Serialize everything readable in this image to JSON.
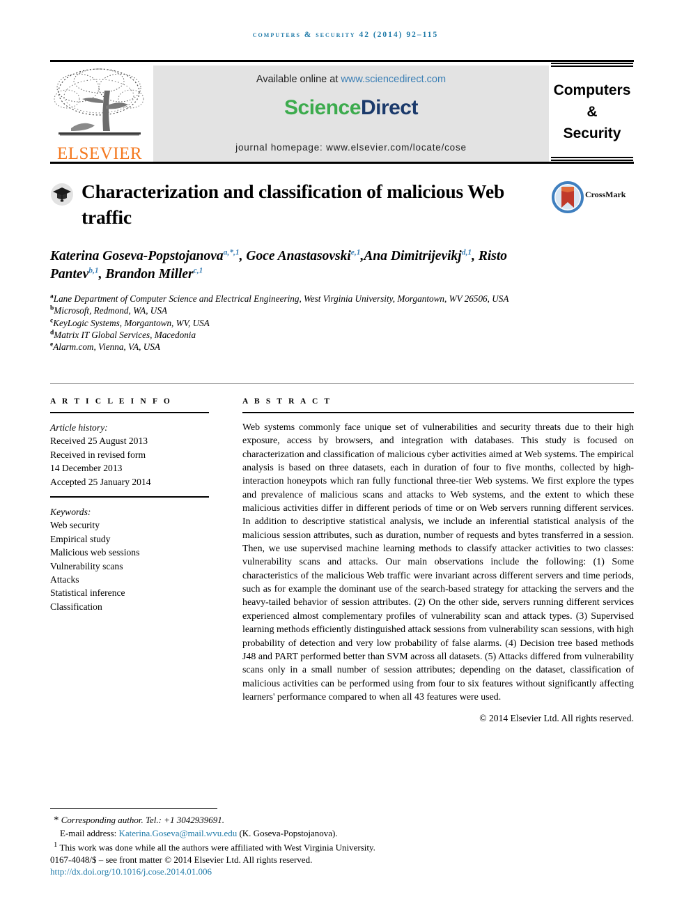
{
  "running_head": "Computers & Security 42 (2014) 92–115",
  "masthead": {
    "available_text": "Available online at",
    "available_url": "www.sciencedirect.com",
    "logo_part1": "Science",
    "logo_part2": "Direct",
    "homepage": "journal homepage: www.elsevier.com/locate/cose",
    "publisher": "ELSEVIER",
    "journal_line1": "Computers",
    "journal_line2": "&",
    "journal_line3": "Security"
  },
  "article": {
    "title": "Characterization and classification of malicious Web traffic",
    "crossmark_label": "CrossMark"
  },
  "authors": {
    "list": [
      {
        "name": "Katerina Goseva-Popstojanova",
        "marks": "a,*,1",
        "sep": ", "
      },
      {
        "name": "Goce Anastasovski",
        "marks": "e,1",
        "sep": ","
      },
      {
        "name": "Ana Dimitrijevikj",
        "marks": "d,1",
        "sep": ", "
      },
      {
        "name": "Risto Pantev",
        "marks": "b,1",
        "sep": ", "
      },
      {
        "name": "Brandon Miller",
        "marks": "c,1",
        "sep": ""
      }
    ]
  },
  "affiliations": [
    {
      "mark": "a",
      "text": "Lane Department of Computer Science and Electrical Engineering, West Virginia University, Morgantown, WV 26506, USA"
    },
    {
      "mark": "b",
      "text": "Microsoft, Redmond, WA, USA"
    },
    {
      "mark": "c",
      "text": "KeyLogic Systems, Morgantown, WV, USA"
    },
    {
      "mark": "d",
      "text": "Matrix IT Global Services, Macedonia"
    },
    {
      "mark": "e",
      "text": "Alarm.com, Vienna, VA, USA"
    }
  ],
  "article_info": {
    "heading": "A R T I C L E   I N F O",
    "history_title": "Article history:",
    "history": [
      "Received 25 August 2013",
      "Received in revised form",
      "14 December 2013",
      "Accepted 25 January 2014"
    ],
    "keywords_title": "Keywords:",
    "keywords": [
      "Web security",
      "Empirical study",
      "Malicious web sessions",
      "Vulnerability scans",
      "Attacks",
      "Statistical inference",
      "Classification"
    ]
  },
  "abstract": {
    "heading": "A B S T R A C T",
    "text": "Web systems commonly face unique set of vulnerabilities and security threats due to their high exposure, access by browsers, and integration with databases. This study is focused on characterization and classification of malicious cyber activities aimed at Web systems. The empirical analysis is based on three datasets, each in duration of four to five months, collected by high-interaction honeypots which ran fully functional three-tier Web systems. We first explore the types and prevalence of malicious scans and attacks to Web systems, and the extent to which these malicious activities differ in different periods of time or on Web servers running different services. In addition to descriptive statistical analysis, we include an inferential statistical analysis of the malicious session attributes, such as duration, number of requests and bytes transferred in a session. Then, we use supervised machine learning methods to classify attacker activities to two classes: vulnerability scans and attacks. Our main observations include the following: (1) Some characteristics of the malicious Web traffic were invariant across different servers and time periods, such as for example the dominant use of the search-based strategy for attacking the servers and the heavy-tailed behavior of session attributes. (2) On the other side, servers running different services experienced almost complementary profiles of vulnerability scan and attack types. (3) Supervised learning methods efficiently distinguished attack sessions from vulnerability scan sessions, with high probability of detection and very low probability of false alarms. (4) Decision tree based methods J48 and PART performed better than SVM across all datasets. (5) Attacks differed from vulnerability scans only in a small number of session attributes; depending on the dataset, classification of malicious activities can be performed using from four to six features without significantly affecting learners' performance compared to when all 43 features were used.",
    "copyright": "© 2014 Elsevier Ltd. All rights reserved."
  },
  "footnotes": {
    "corresponding": "Corresponding author. Tel.: +1 3042939691.",
    "email_label": "E-mail address:",
    "email": "Katerina.Goseva@mail.wvu.edu",
    "email_attrib": "(K. Goseva-Popstojanova).",
    "note1_mark": "1",
    "note1": "This work was done while all the authors were affiliated with West Virginia University.",
    "issn_line": "0167-4048/$ – see front matter © 2014 Elsevier Ltd. All rights reserved.",
    "doi": "http://dx.doi.org/10.1016/j.cose.2014.01.006"
  },
  "colors": {
    "link": "#1f7aa8",
    "elsevier_orange": "#f47920",
    "sd_green": "#3cab4d",
    "sd_navy": "#1b3a6b"
  }
}
